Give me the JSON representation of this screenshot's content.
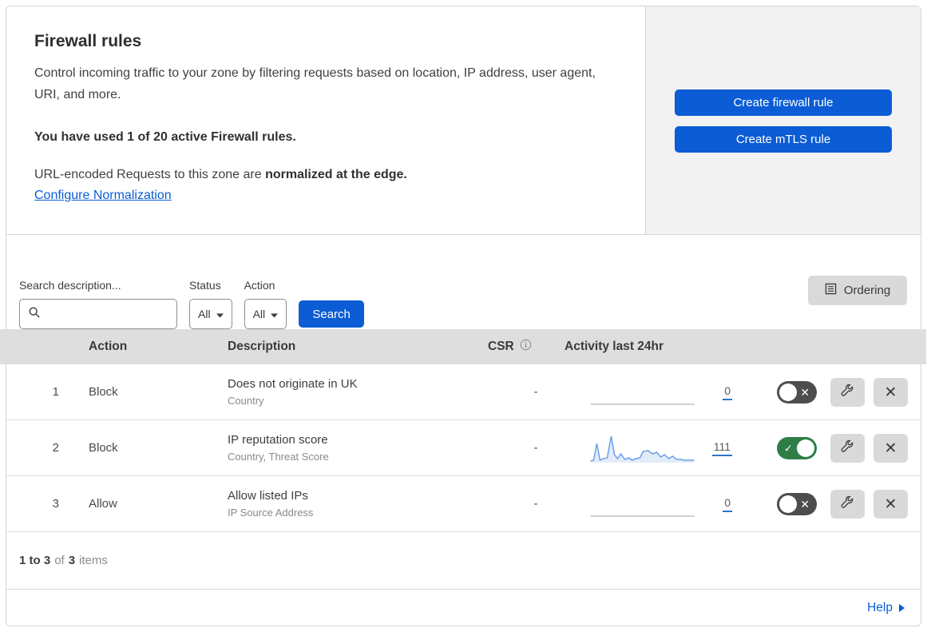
{
  "header": {
    "title": "Firewall rules",
    "description": "Control incoming traffic to your zone by filtering requests based on location, IP address, user agent, URI, and more.",
    "usage_bold": "You have used 1 of 20 active Firewall rules.",
    "normalization_prefix": "URL-encoded Requests to this zone are ",
    "normalization_bold": "normalized at the edge.",
    "normalization_link": "Configure Normalization",
    "create_firewall_button": "Create firewall rule",
    "create_mtls_button": "Create mTLS rule"
  },
  "filters": {
    "search_label": "Search description...",
    "search_value": "",
    "status_label": "Status",
    "status_value": "All",
    "action_label": "Action",
    "action_value": "All",
    "search_button": "Search",
    "ordering_button": "Ordering"
  },
  "table": {
    "headers": {
      "action": "Action",
      "description": "Description",
      "csr": "CSR",
      "activity": "Activity last 24hr"
    },
    "rows": [
      {
        "num": "1",
        "action": "Block",
        "description": "Does not originate in UK",
        "fields": "Country",
        "csr": "-",
        "activity_count": "0",
        "enabled": false,
        "sparkline_points": null
      },
      {
        "num": "2",
        "action": "Block",
        "description": "IP reputation score",
        "fields": "Country, Threat Score",
        "csr": "-",
        "activity_count": "111",
        "enabled": true,
        "sparkline_points": [
          [
            0,
            34
          ],
          [
            4,
            33
          ],
          [
            8,
            12
          ],
          [
            12,
            33
          ],
          [
            16,
            31
          ],
          [
            21,
            30
          ],
          [
            26,
            3
          ],
          [
            30,
            26
          ],
          [
            34,
            31
          ],
          [
            38,
            25
          ],
          [
            43,
            32
          ],
          [
            48,
            30
          ],
          [
            52,
            33
          ],
          [
            57,
            31
          ],
          [
            62,
            30
          ],
          [
            66,
            22
          ],
          [
            72,
            21
          ],
          [
            78,
            25
          ],
          [
            83,
            23
          ],
          [
            88,
            29
          ],
          [
            93,
            26
          ],
          [
            98,
            31
          ],
          [
            103,
            28
          ],
          [
            108,
            32
          ],
          [
            113,
            32
          ],
          [
            118,
            33
          ],
          [
            124,
            33
          ],
          [
            130,
            33
          ]
        ]
      },
      {
        "num": "3",
        "action": "Allow",
        "description": "Allow listed IPs",
        "fields": "IP Source Address",
        "csr": "-",
        "activity_count": "0",
        "enabled": false,
        "sparkline_points": null
      }
    ]
  },
  "footer": {
    "range": "1 to 3",
    "of": "of",
    "total": "3",
    "items": "items",
    "help": "Help"
  },
  "icons": {
    "check_glyph": "✓",
    "x_glyph": "✕"
  },
  "colors": {
    "accent_blue": "#0b5cd5",
    "toggle_on_green": "#2e7d46",
    "toggle_off_gray": "#4d4d4d",
    "sparkline_line": "#6d9eea",
    "sparkline_fill": "#e3ecf9",
    "table_header_bg": "#dedede",
    "side_panel_bg": "#f2f2f2"
  }
}
